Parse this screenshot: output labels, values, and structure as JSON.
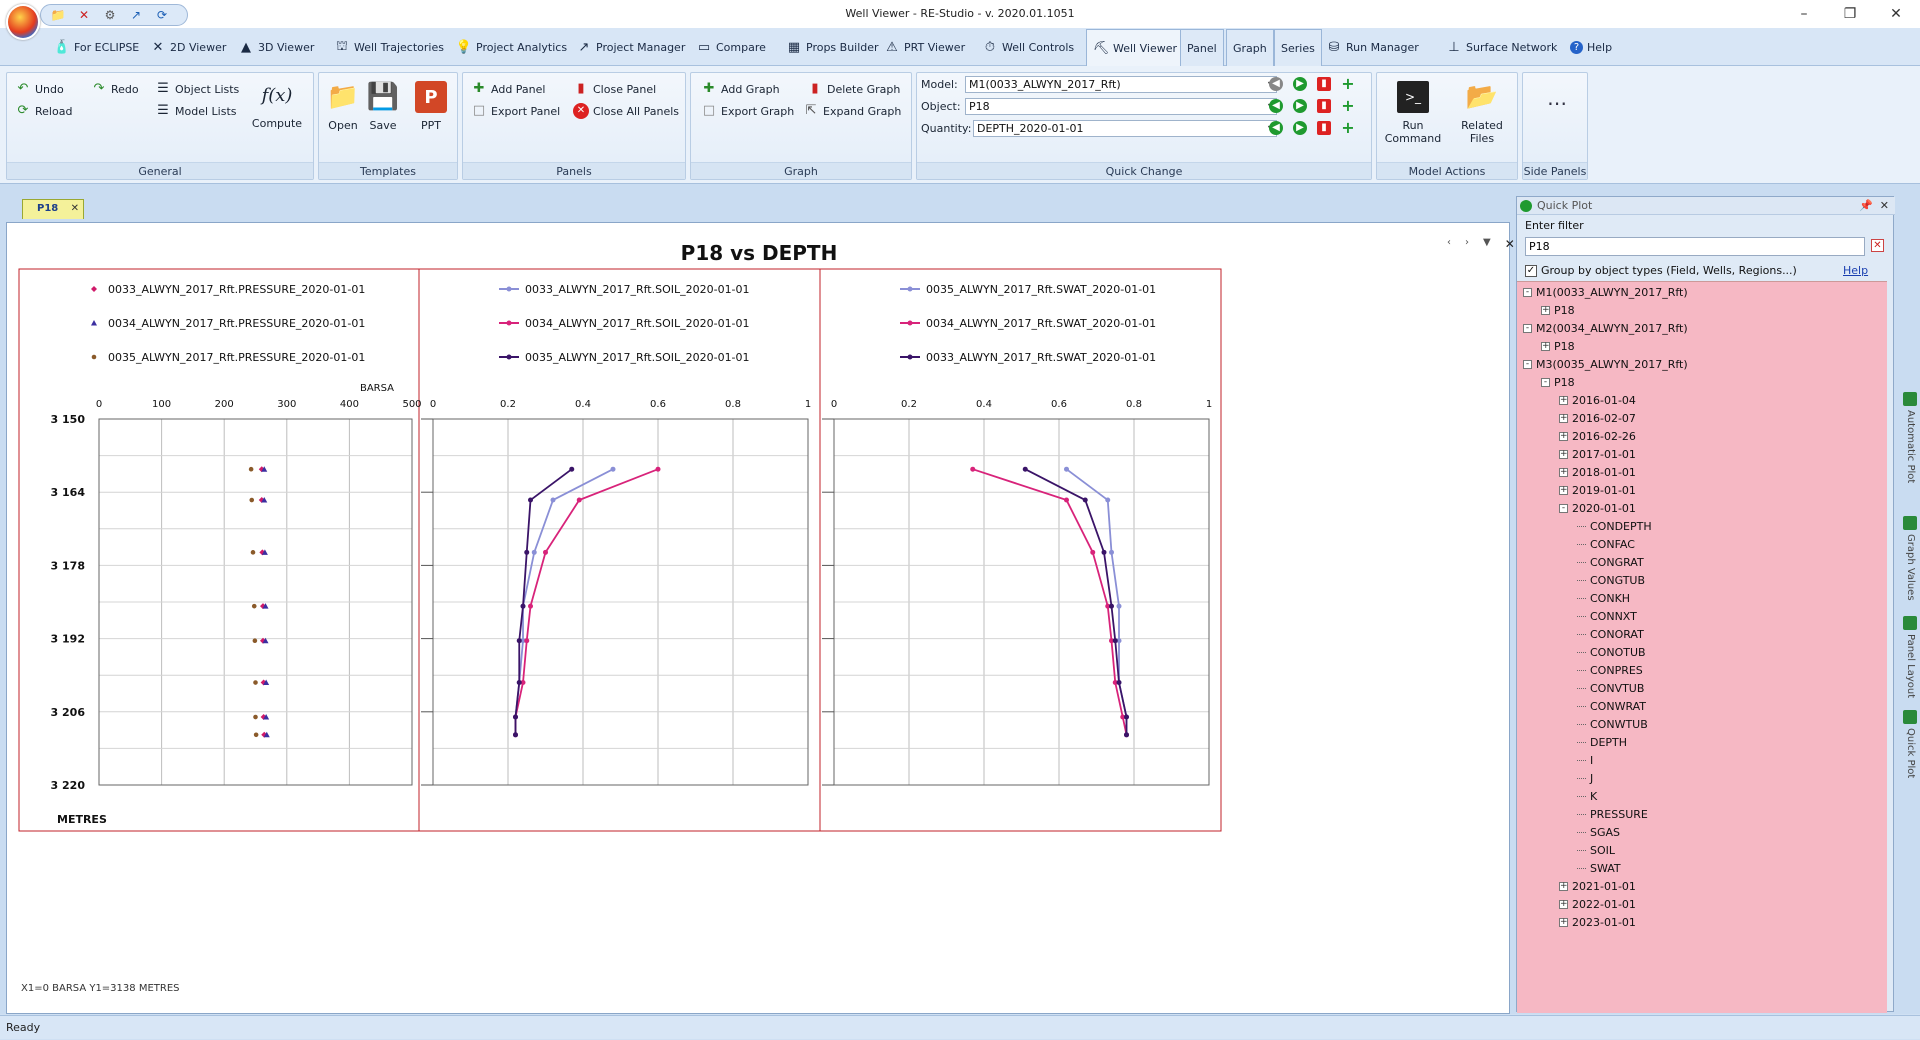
{
  "window": {
    "title": "Well Viewer - RE-Studio - v. 2020.01.1051"
  },
  "menu": {
    "tabs": [
      {
        "label": "For ECLIPSE",
        "icon": "bottle-icon"
      },
      {
        "label": "2D Viewer",
        "icon": "2d-viewer-icon"
      },
      {
        "label": "3D Viewer",
        "icon": "3d-viewer-icon"
      },
      {
        "label": "Well Trajectories",
        "icon": "derrick-icon"
      },
      {
        "label": "Project Analytics",
        "icon": "lightbulb-icon"
      },
      {
        "label": "Project Manager",
        "icon": "project-manager-icon"
      },
      {
        "label": "Compare",
        "icon": "compare-icon"
      },
      {
        "label": "Props Builder",
        "icon": "props-builder-icon"
      },
      {
        "label": "PRT Viewer",
        "icon": "prt-viewer-icon"
      },
      {
        "label": "Well Controls",
        "icon": "well-controls-icon"
      },
      {
        "label": "Well Viewer",
        "icon": "well-viewer-icon"
      },
      {
        "label": "Panel"
      },
      {
        "label": "Graph"
      },
      {
        "label": "Series"
      },
      {
        "label": "Run Manager",
        "icon": "database-icon"
      },
      {
        "label": "Surface Network",
        "icon": "surface-network-icon"
      },
      {
        "label": "Help",
        "icon": "help-icon"
      }
    ]
  },
  "ribbon": {
    "general": {
      "label": "General",
      "undo": "Undo",
      "redo": "Redo",
      "reload": "Reload",
      "object_lists": "Object Lists",
      "model_lists": "Model Lists",
      "compute": "Compute",
      "fx": "f(x)"
    },
    "templates": {
      "label": "Templates",
      "open": "Open",
      "save": "Save",
      "ppt": "PPT"
    },
    "panels": {
      "label": "Panels",
      "add": "Add Panel",
      "close": "Close Panel",
      "export": "Export Panel",
      "close_all": "Close All Panels"
    },
    "graph": {
      "label": "Graph",
      "add": "Add Graph",
      "delete": "Delete Graph",
      "export": "Export Graph",
      "expand": "Expand Graph"
    },
    "quick_change": {
      "label": "Quick Change",
      "model_label": "Model:",
      "model_value": "M1(0033_ALWYN_2017_Rft)",
      "object_label": "Object:",
      "object_value": "P18",
      "quantity_label": "Quantity:",
      "quantity_value": "DEPTH_2020-01-01"
    },
    "model_actions": {
      "label": "Model Actions",
      "run_command": "Run\nCommand",
      "related_files": "Related\nFiles"
    },
    "side_panels": {
      "label": "Side Panels"
    }
  },
  "document": {
    "tab": "P18"
  },
  "panel": {
    "title": "P18 vs DEPTH",
    "coord_readout": "X1=0 BARSA  Y1=3138 METRES"
  },
  "chart_data": {
    "type": "line",
    "title": "P18 vs DEPTH",
    "ylabel": "METRES",
    "ylim": [
      3220,
      3150
    ],
    "yticks": [
      "3 150",
      "3 164",
      "3 178",
      "3 192",
      "3 206",
      "3 220"
    ],
    "grid": true,
    "legend_position": "top",
    "depths": [
      3159.6,
      3165.5,
      3175.5,
      3185.8,
      3192.4,
      3200.4,
      3207.0,
      3210.4
    ],
    "tracks": [
      {
        "xlabel": "BARSA",
        "xlim": [
          0,
          500
        ],
        "xticks": [
          "0",
          "100",
          "200",
          "300",
          "400",
          "500"
        ],
        "markers_only": true,
        "series": [
          {
            "name": "0033_ALWYN_2017_Rft.PRESSURE_2020-01-01",
            "color": "#d01a6a",
            "marker": "diamond",
            "values": [
              260,
              260,
              261,
              262,
              262,
              263,
              263,
              264
            ]
          },
          {
            "name": "0034_ALWYN_2017_Rft.PRESSURE_2020-01-01",
            "color": "#3b2ea0",
            "marker": "triangle",
            "values": [
              264,
              264,
              265,
              266,
              266,
              267,
              267,
              268
            ]
          },
          {
            "name": "0035_ALWYN_2017_Rft.PRESSURE_2020-01-01",
            "color": "#8a5a2a",
            "marker": "circle",
            "values": [
              243,
              244,
              246,
              248,
              249,
              250,
              250,
              251
            ]
          }
        ]
      },
      {
        "xlim": [
          0,
          1
        ],
        "xticks": [
          "0",
          "0.2",
          "0.4",
          "0.6",
          "0.8",
          "1"
        ],
        "series": [
          {
            "name": "0033_ALWYN_2017_Rft.SOIL_2020-01-01",
            "color": "#8a8fd6",
            "values": [
              0.48,
              0.32,
              0.27,
              0.24,
              0.24,
              0.23,
              0.22,
              0.22
            ]
          },
          {
            "name": "0034_ALWYN_2017_Rft.SOIL_2020-01-01",
            "color": "#d8237a",
            "values": [
              0.6,
              0.39,
              0.3,
              0.26,
              0.25,
              0.24,
              0.22,
              0.22
            ]
          },
          {
            "name": "0035_ALWYN_2017_Rft.SOIL_2020-01-01",
            "color": "#3a1468",
            "values": [
              0.37,
              0.26,
              0.25,
              0.24,
              0.23,
              0.23,
              0.22,
              0.22
            ]
          }
        ]
      },
      {
        "xlim": [
          0,
          1
        ],
        "xticks": [
          "0",
          "0.2",
          "0.4",
          "0.6",
          "0.8",
          "1"
        ],
        "series": [
          {
            "name": "0035_ALWYN_2017_Rft.SWAT_2020-01-01",
            "color": "#8a8fd6",
            "values": [
              0.62,
              0.73,
              0.74,
              0.76,
              0.76,
              0.76,
              0.78,
              0.78
            ]
          },
          {
            "name": "0034_ALWYN_2017_Rft.SWAT_2020-01-01",
            "color": "#d8237a",
            "values": [
              0.37,
              0.62,
              0.69,
              0.73,
              0.74,
              0.75,
              0.77,
              0.78
            ]
          },
          {
            "name": "0033_ALWYN_2017_Rft.SWAT_2020-01-01",
            "color": "#3a1468",
            "values": [
              0.51,
              0.67,
              0.72,
              0.74,
              0.75,
              0.76,
              0.78,
              0.78
            ]
          }
        ]
      }
    ]
  },
  "quick_plot": {
    "title": "Quick Plot",
    "filter_label": "Enter filter",
    "filter_value": "P18",
    "group_by_label": "Group by object types (Field, Wells, Regions...)",
    "help_label": "Help",
    "tree": [
      {
        "label": "M1(0033_ALWYN_2017_Rft)",
        "level": 0,
        "exp": "-"
      },
      {
        "label": "P18",
        "level": 1,
        "exp": "+"
      },
      {
        "label": "M2(0034_ALWYN_2017_Rft)",
        "level": 0,
        "exp": "-"
      },
      {
        "label": "P18",
        "level": 1,
        "exp": "+"
      },
      {
        "label": "M3(0035_ALWYN_2017_Rft)",
        "level": 0,
        "exp": "-"
      },
      {
        "label": "P18",
        "level": 1,
        "exp": "-"
      },
      {
        "label": "2016-01-04",
        "level": 2,
        "exp": "+"
      },
      {
        "label": "2016-02-07",
        "level": 2,
        "exp": "+"
      },
      {
        "label": "2016-02-26",
        "level": 2,
        "exp": "+"
      },
      {
        "label": "2017-01-01",
        "level": 2,
        "exp": "+"
      },
      {
        "label": "2018-01-01",
        "level": 2,
        "exp": "+"
      },
      {
        "label": "2019-01-01",
        "level": 2,
        "exp": "+"
      },
      {
        "label": "2020-01-01",
        "level": 2,
        "exp": "-"
      },
      {
        "label": "CONDEPTH",
        "level": 3
      },
      {
        "label": "CONFAC",
        "level": 3
      },
      {
        "label": "CONGRAT",
        "level": 3
      },
      {
        "label": "CONGTUB",
        "level": 3
      },
      {
        "label": "CONKH",
        "level": 3
      },
      {
        "label": "CONNXT",
        "level": 3
      },
      {
        "label": "CONORAT",
        "level": 3
      },
      {
        "label": "CONOTUB",
        "level": 3
      },
      {
        "label": "CONPRES",
        "level": 3
      },
      {
        "label": "CONVTUB",
        "level": 3
      },
      {
        "label": "CONWRAT",
        "level": 3
      },
      {
        "label": "CONWTUB",
        "level": 3
      },
      {
        "label": "DEPTH",
        "level": 3
      },
      {
        "label": "I",
        "level": 3
      },
      {
        "label": "J",
        "level": 3
      },
      {
        "label": "K",
        "level": 3
      },
      {
        "label": "PRESSURE",
        "level": 3
      },
      {
        "label": "SGAS",
        "level": 3
      },
      {
        "label": "SOIL",
        "level": 3
      },
      {
        "label": "SWAT",
        "level": 3
      },
      {
        "label": "2021-01-01",
        "level": 2,
        "exp": "+"
      },
      {
        "label": "2022-01-01",
        "level": 2,
        "exp": "+"
      },
      {
        "label": "2023-01-01",
        "level": 2,
        "exp": "+"
      }
    ]
  },
  "side_tabs": [
    "Automatic Plot",
    "Graph Values",
    "Panel Layout",
    "Quick Plot"
  ],
  "status": {
    "text": "Ready"
  }
}
